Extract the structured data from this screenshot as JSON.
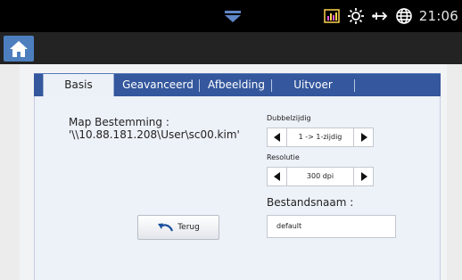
{
  "status_bar": {
    "time": "21:06",
    "icons": [
      "pulldown-handle-icon",
      "signal-bars-icon",
      "brightness-icon",
      "network-icon",
      "globe-icon"
    ]
  },
  "header": {
    "home_icon": "home-icon"
  },
  "tabs": [
    {
      "label": "Basis",
      "active": true
    },
    {
      "label": "Geavanceerd",
      "active": false
    },
    {
      "label": "Afbeelding",
      "active": false
    },
    {
      "label": "Uitvoer",
      "active": false
    }
  ],
  "destination": {
    "label": "Map Bestemming :",
    "value": "'\\\\10.88.181.208\\User\\sc00.kim'"
  },
  "duplex": {
    "label": "Dubbelzijdig",
    "value": "1 -> 1-zijdig"
  },
  "resolution": {
    "label": "Resolutie",
    "value": "300 dpi"
  },
  "filename": {
    "label": "Bestandsnaam :",
    "value": "default"
  },
  "back_button": {
    "label": "Terug",
    "icon": "undo-arrow-icon"
  },
  "colors": {
    "tab_bar": "#34579d",
    "panel": "#edf1f8",
    "home_button": "#4d7fbf",
    "status_bar": "#000000"
  }
}
